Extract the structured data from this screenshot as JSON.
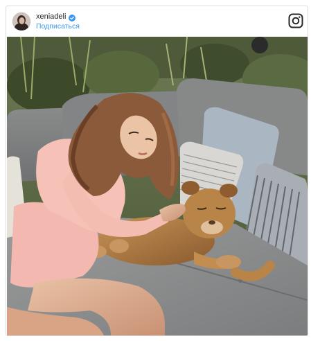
{
  "post": {
    "username": "xeniadeli",
    "follow_label": "Подписаться",
    "verified": true
  },
  "icons": {
    "avatar": "profile-avatar",
    "verified": "verified-badge-icon",
    "brand": "instagram-icon"
  },
  "colors": {
    "link": "#3897f0",
    "verified": "#3897f0",
    "border": "#dbdbdb",
    "text": "#262626"
  }
}
